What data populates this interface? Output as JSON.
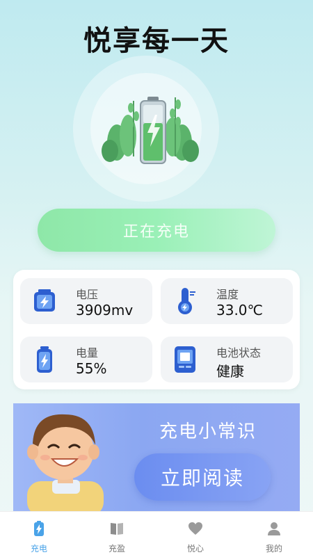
{
  "header": {
    "title": "悦享每一天"
  },
  "charge": {
    "button_label": "正在充电"
  },
  "stats": [
    {
      "label": "电压",
      "value": "3909mv",
      "icon": "battery-bolt-icon"
    },
    {
      "label": "温度",
      "value": "33.0℃",
      "icon": "thermometer-icon"
    },
    {
      "label": "电量",
      "value": "55%",
      "icon": "battery-level-icon"
    },
    {
      "label": "电池状态",
      "value": "健康",
      "icon": "device-status-icon"
    }
  ],
  "banner": {
    "title": "充电小常识",
    "button_label": "立即阅读"
  },
  "tabs": [
    {
      "label": "充电",
      "icon": "battery-tab-icon",
      "active": true
    },
    {
      "label": "充盈",
      "icon": "book-tab-icon",
      "active": false
    },
    {
      "label": "悦心",
      "icon": "heart-tab-icon",
      "active": false
    },
    {
      "label": "我的",
      "icon": "user-tab-icon",
      "active": false
    }
  ],
  "colors": {
    "accent": "#4aa3e8",
    "charge_green": "#8ee7a8",
    "banner_blue": "#8ba7f2"
  }
}
